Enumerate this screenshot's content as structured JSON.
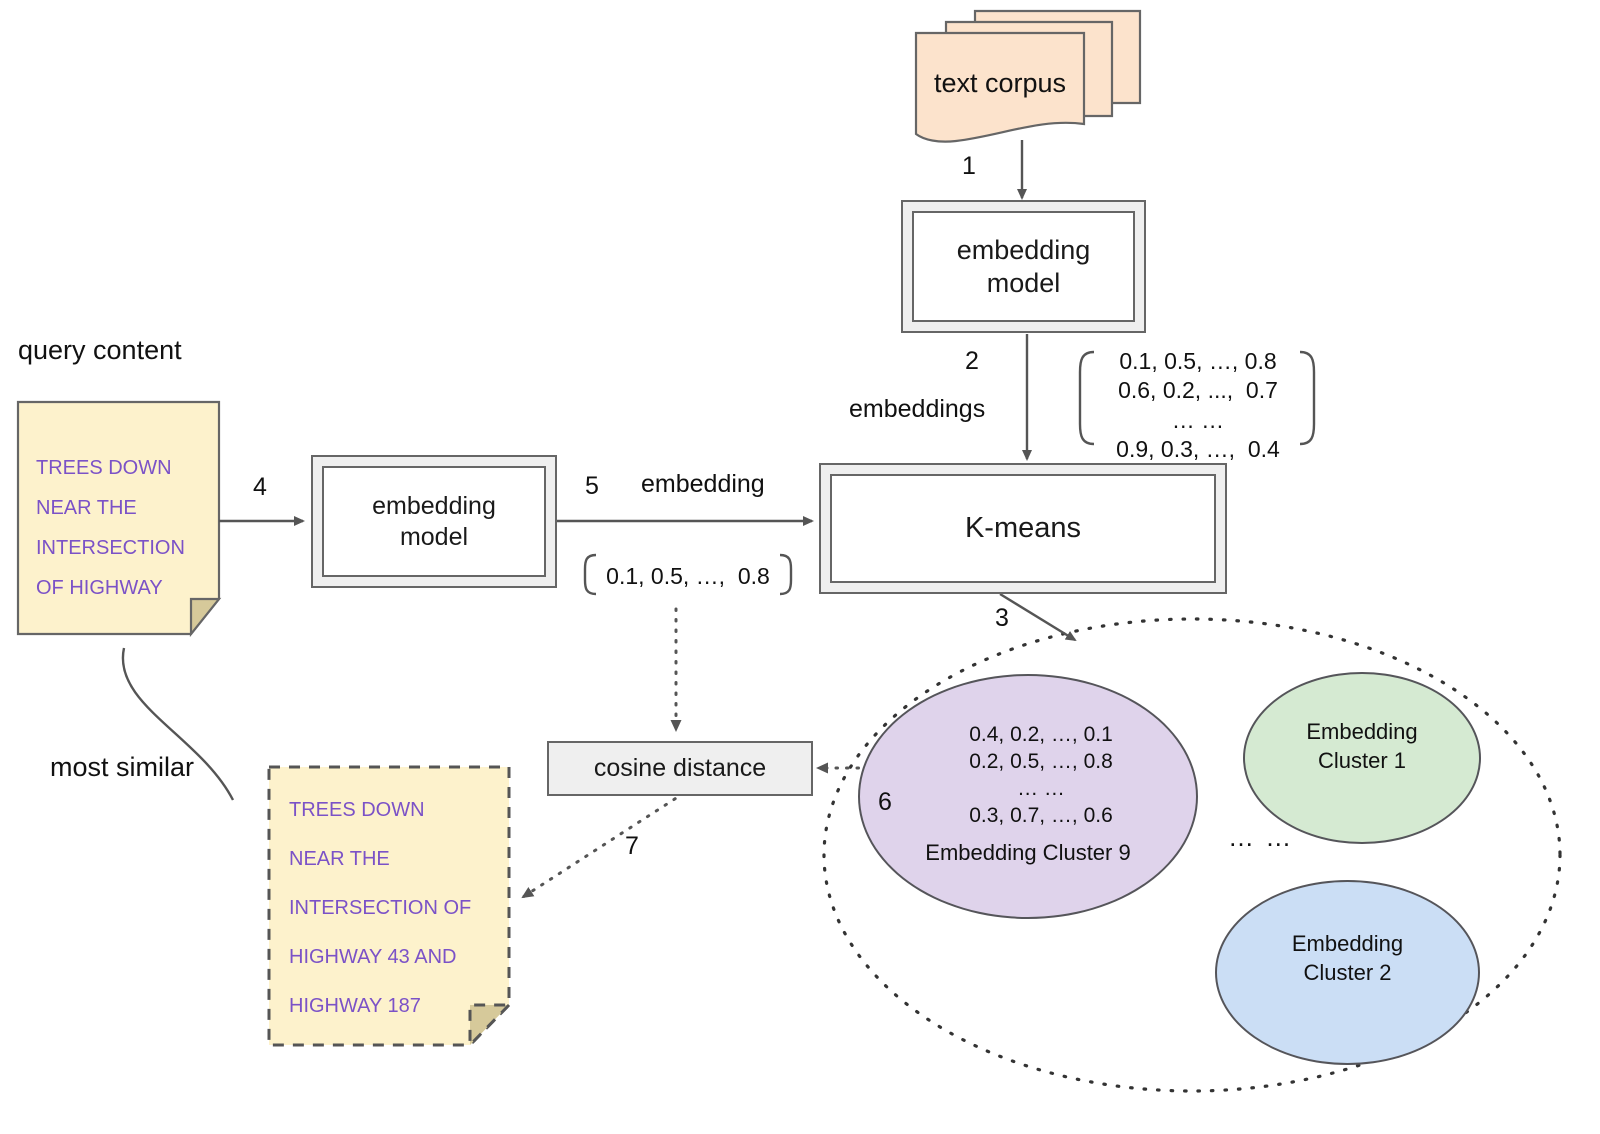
{
  "diagram": {
    "title_nodes": {
      "text_corpus": "text corpus",
      "embedding_model_top": "embedding\nmodel",
      "embedding_model_query": "embedding\nmodel",
      "kmeans": "K-means",
      "cosine_distance": "cosine distance"
    },
    "labels": {
      "query_content": "query content",
      "most_similar": "most similar",
      "embeddings": "embeddings",
      "embedding": "embedding",
      "ellipsis": "… …"
    },
    "steps": {
      "s1": "1",
      "s2": "2",
      "s3": "3",
      "s4": "4",
      "s5": "5",
      "s6": "6",
      "s7": "7"
    },
    "notes": {
      "query_note": {
        "lines": [
          "TREES DOWN",
          "NEAR THE",
          "INTERSECTION",
          "OF HIGHWAY"
        ],
        "text": "TREES DOWN\nNEAR THE\nINTERSECTION\nOF HIGHWAY"
      },
      "result_note": {
        "lines": [
          "TREES DOWN",
          "NEAR THE",
          "INTERSECTION OF",
          "HIGHWAY 43 AND",
          "HIGHWAY 187"
        ],
        "text": "TREES DOWN\nNEAR THE\nINTERSECTION OF\nHIGHWAY 43 AND\nHIGHWAY 187"
      }
    },
    "matrices": {
      "corpus_embeddings": {
        "rows": [
          "0.1, 0.5, …, 0.8",
          "0.6, 0.2, ...,  0.7",
          "… …",
          "0.9, 0.3, …,  0.4"
        ],
        "text": "0.1, 0.5, …, 0.8\n0.6, 0.2, ...,  0.7\n… …\n0.9, 0.3, …,  0.4"
      },
      "query_embedding": {
        "rows": [
          "0.1, 0.5, …,  0.8"
        ],
        "text": "0.1, 0.5, …,  0.8"
      },
      "cluster9_embeddings": {
        "rows": [
          "0.4, 0.2, …, 0.1",
          "0.2, 0.5, …, 0.8",
          "… …",
          "0.3, 0.7, …, 0.6"
        ],
        "text": "0.4, 0.2, …, 0.1\n0.2, 0.5, …, 0.8\n… …\n0.3, 0.7, …, 0.6"
      }
    },
    "clusters": [
      {
        "id": "cluster9",
        "label": "Embedding Cluster 9",
        "color": "#dfd3eb"
      },
      {
        "id": "cluster1",
        "label": "Embedding\nCluster 1",
        "color": "#d5ead2"
      },
      {
        "id": "cluster2",
        "label": "Embedding\nCluster 2",
        "color": "#cbdef5"
      }
    ],
    "colors": {
      "corpus_fill": "#fce3cc",
      "note_fill": "#fdf2cc",
      "note_fold": "#d6c99a",
      "note_text": "#7b52c7",
      "module_fill": "#efefef",
      "stroke": "#666666",
      "cluster_stroke": "#55555a",
      "cluster9_fill": "#dfd3eb",
      "cluster1_fill": "#d5ead2",
      "cluster2_fill": "#cbdef5"
    }
  }
}
